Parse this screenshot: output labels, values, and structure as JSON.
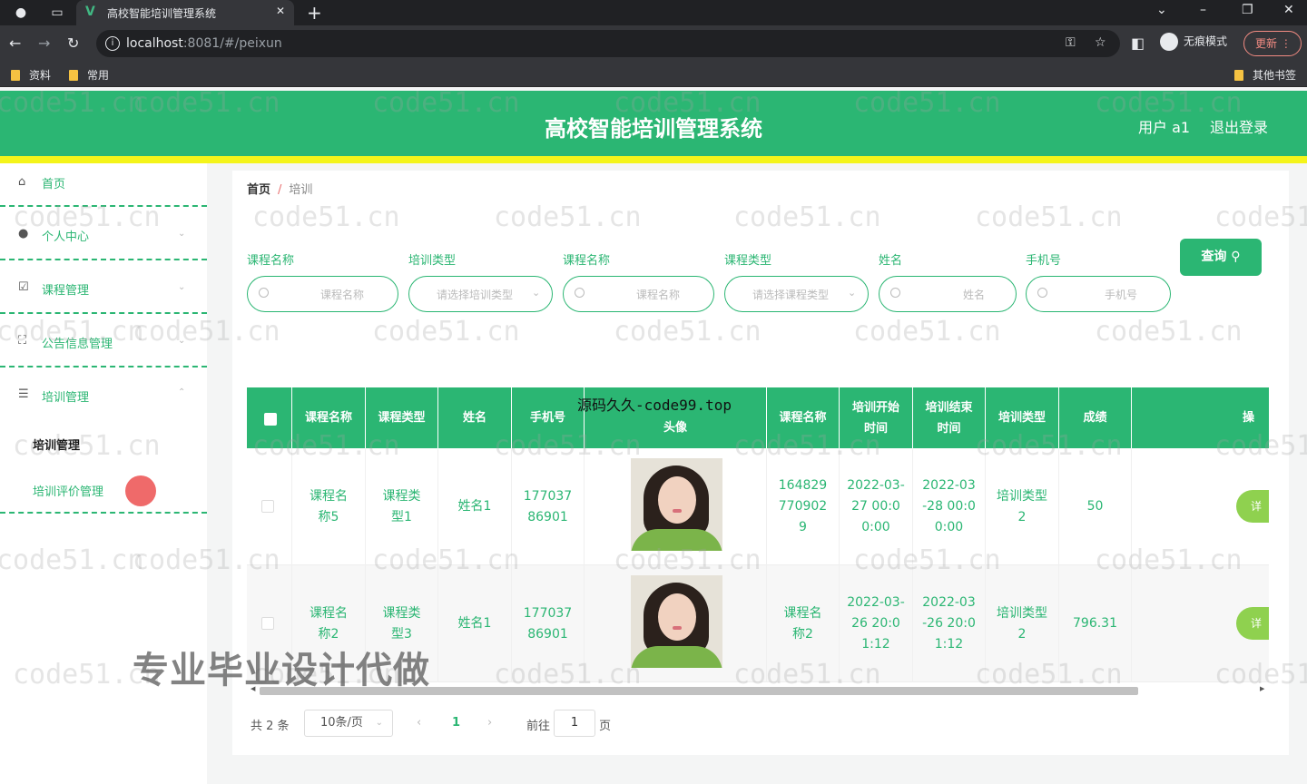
{
  "browser": {
    "tab_title": "高校智能培训管理系统",
    "url_host": "localhost",
    "url_rest": ":8081/#/peixun",
    "incognito_label": "无痕模式",
    "update_label": "更新",
    "bookmarks": [
      "资料",
      "常用"
    ],
    "other_bookmarks": "其他书签"
  },
  "header": {
    "title": "高校智能培训管理系统",
    "user": "用户 a1",
    "logout": "退出登录"
  },
  "sidebar": {
    "items": [
      {
        "label": "首页",
        "icon": "home-icon"
      },
      {
        "label": "个人中心",
        "icon": "user-icon"
      },
      {
        "label": "课程管理",
        "icon": "edit-icon"
      },
      {
        "label": "公告信息管理",
        "icon": "fullscreen-icon"
      },
      {
        "label": "培训管理",
        "icon": "menu-icon"
      }
    ],
    "sub_items": [
      "培训管理",
      "培训评价管理"
    ]
  },
  "breadcrumb": {
    "home": "首页",
    "sep": "/",
    "current": "培训"
  },
  "filters": [
    {
      "label": "课程名称",
      "placeholder": "课程名称",
      "type": "search"
    },
    {
      "label": "培训类型",
      "placeholder": "请选择培训类型",
      "type": "select"
    },
    {
      "label": "课程名称",
      "placeholder": "课程名称",
      "type": "search"
    },
    {
      "label": "课程类型",
      "placeholder": "请选择课程类型",
      "type": "select"
    },
    {
      "label": "姓名",
      "placeholder": "姓名",
      "type": "search"
    },
    {
      "label": "手机号",
      "placeholder": "手机号",
      "type": "search"
    }
  ],
  "query_button": "查询",
  "table": {
    "columns": [
      "课程名称",
      "课程类型",
      "姓名",
      "手机号",
      "头像",
      "课程名称",
      "培训开始时间",
      "培训结束时间",
      "培训类型",
      "成绩",
      "操"
    ],
    "rows": [
      {
        "course": "课程名称5",
        "course_type": "课程类型1",
        "name": "姓名1",
        "phone": "17703786901",
        "course2": "1648297709029",
        "start": "2022-03-27 00:00:00",
        "end": "2022-03-28 00:00:00",
        "train_type": "培训类型2",
        "score": "50",
        "op": "详"
      },
      {
        "course": "课程名称2",
        "course_type": "课程类型3",
        "name": "姓名1",
        "phone": "17703786901",
        "course2": "课程名称2",
        "start": "2022-03-26 20:01:12",
        "end": "2022-03-26 20:01:12",
        "train_type": "培训类型2",
        "score": "796.31",
        "op": "详"
      }
    ]
  },
  "pagination": {
    "total": "共 2 条",
    "page_size": "10条/页",
    "prev": "‹",
    "current": "1",
    "next": "›",
    "goto": "前往",
    "goto_value": "1",
    "unit": "页"
  },
  "overlays": {
    "source_text": "源码久久-code99.top",
    "ad_text": "专业毕业设计代做",
    "watermark": "code51.cn"
  },
  "colors": {
    "primary": "#2bb673",
    "stripe": "#f4f41a",
    "op_button": "#8fd14f"
  }
}
